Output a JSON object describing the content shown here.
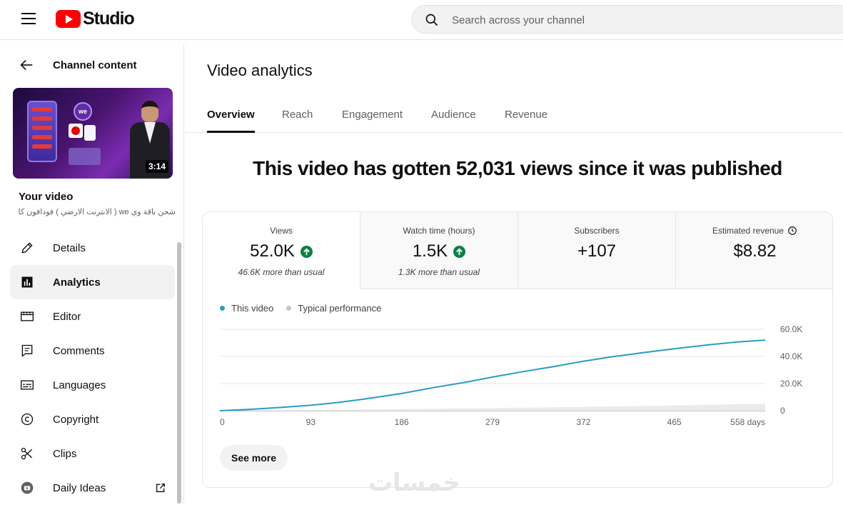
{
  "app": {
    "logo_text": "Studio",
    "search_placeholder": "Search across your channel"
  },
  "sidebar": {
    "back_label": "Channel content",
    "thumbnail": {
      "duration": "3:14",
      "badge": "we"
    },
    "your_video_label": "Your video",
    "video_title": "شحن باقة وي we ( الانترنت الارضي ) فودافون كاش...",
    "items": [
      {
        "label": "Details",
        "icon": "pencil-icon"
      },
      {
        "label": "Analytics",
        "icon": "analytics-icon",
        "active": true
      },
      {
        "label": "Editor",
        "icon": "film-strip-icon"
      },
      {
        "label": "Comments",
        "icon": "comment-icon"
      },
      {
        "label": "Languages",
        "icon": "subtitles-icon"
      },
      {
        "label": "Copyright",
        "icon": "copyright-icon"
      },
      {
        "label": "Clips",
        "icon": "scissors-icon"
      },
      {
        "label": "Daily Ideas",
        "icon": "ideas-icon"
      }
    ]
  },
  "main": {
    "title": "Video analytics",
    "tabs": [
      {
        "label": "Overview",
        "active": true
      },
      {
        "label": "Reach"
      },
      {
        "label": "Engagement"
      },
      {
        "label": "Audience"
      },
      {
        "label": "Revenue"
      }
    ],
    "headline": "This video has gotten 52,031 views since it was published",
    "metrics": [
      {
        "label": "Views",
        "value": "52.0K",
        "trend": "up",
        "sub": "46.6K more than usual"
      },
      {
        "label": "Watch time (hours)",
        "value": "1.5K",
        "trend": "up",
        "sub": "1.3K more than usual"
      },
      {
        "label": "Subscribers",
        "value": "+107",
        "sub": ""
      },
      {
        "label": "Estimated revenue",
        "value": "$8.82",
        "sub": ""
      }
    ],
    "see_more": "See more"
  },
  "watermark": "خمسات",
  "colors": {
    "accent_line": "#289cc5",
    "typical_area": "#ebebeb",
    "trend_up": "#0b8043",
    "brand_red": "#ff0000"
  },
  "chart_data": {
    "type": "line",
    "legend_placement": "top-left",
    "x_tick_labels": [
      "0",
      "93",
      "186",
      "279",
      "372",
      "465",
      "558 days"
    ],
    "y_tick_labels": [
      "60.0K",
      "40.0K",
      "20.0K",
      "0"
    ],
    "xlim": [
      0,
      558
    ],
    "ylim": [
      0,
      60000
    ],
    "grid": true,
    "series": [
      {
        "name": "This video",
        "x": [
          0,
          30,
          60,
          93,
          120,
          150,
          186,
          220,
          250,
          279,
          310,
          340,
          372,
          400,
          430,
          465,
          500,
          530,
          558
        ],
        "y": [
          0,
          1000,
          2300,
          4000,
          6000,
          8800,
          12700,
          17200,
          20800,
          24800,
          28800,
          32300,
          36500,
          39600,
          42500,
          45700,
          48600,
          50700,
          52031
        ]
      },
      {
        "name": "Typical performance",
        "x": [
          0,
          93,
          186,
          279,
          372,
          465,
          558
        ],
        "y": [
          0,
          500,
          1200,
          2000,
          2800,
          3800,
          5200
        ]
      }
    ]
  }
}
